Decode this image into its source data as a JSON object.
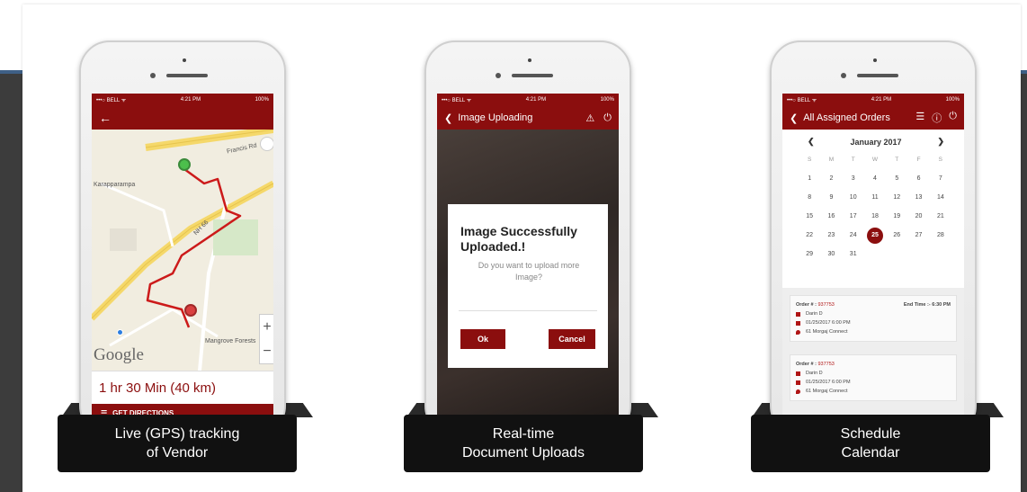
{
  "colors": {
    "brand_red": "#8b0e0e",
    "accent_blue": "#3e5f86",
    "caption_bg": "#111111"
  },
  "phones": [
    {
      "status": {
        "carrier": "•••○ BELL ᯤ",
        "time": "4:21 PM",
        "battery": "100%"
      },
      "appbar": {
        "icon": "back-arrow-icon"
      },
      "map": {
        "labels": [
          "Karapparampa",
          "Mangrove Forests",
          "Francis Rd",
          "NH 66"
        ],
        "google": "Google"
      },
      "eta": "1 hr 30 Min (40 km)",
      "directions_label": "GET DIRECTIONS",
      "caption": [
        "Live (GPS) tracking",
        "of Vendor"
      ]
    },
    {
      "status": {
        "carrier": "•••○ BELL ᯤ",
        "time": "4:21 PM",
        "battery": "100%"
      },
      "appbar": {
        "title": "Image Uploading"
      },
      "dialog": {
        "title_1": "Image Successfully",
        "title_2": "Uploaded.!",
        "message": "Do you want to upload more Image?",
        "ok": "Ok",
        "cancel": "Cancel"
      },
      "caption": [
        "Real-time",
        "Document Uploads"
      ]
    },
    {
      "status": {
        "carrier": "•••○ BELL ᯤ",
        "time": "4:21 PM",
        "battery": "100%"
      },
      "appbar": {
        "title": "All Assigned Orders"
      },
      "calendar": {
        "month": "January 2017",
        "weekdays": [
          "S",
          "M",
          "T",
          "W",
          "T",
          "F",
          "S"
        ],
        "days": [
          "",
          "",
          "",
          "",
          "",
          "",
          "",
          "1",
          "2",
          "3",
          "4",
          "5",
          "6",
          "7",
          "8",
          "9",
          "10",
          "11",
          "12",
          "13",
          "14",
          "15",
          "16",
          "17",
          "18",
          "19",
          "20",
          "21",
          "22",
          "23",
          "24",
          "25",
          "26",
          "27",
          "28",
          "29",
          "30",
          "31"
        ],
        "selected": "25"
      },
      "orders": [
        {
          "order_label": "Order # :",
          "order_no": "937753",
          "name": "Darin D",
          "date": "01/25/2017 6:00 PM",
          "address": "61 Morgaj Connect",
          "end_time": "End Time :- 6:30 PM"
        },
        {
          "order_label": "Order # :",
          "order_no": "937753",
          "name": "Darin D",
          "date": "01/25/2017 6:00 PM",
          "address": "61 Morgaj Connect",
          "end_time": ""
        }
      ],
      "caption": [
        "Schedule",
        "Calendar"
      ]
    }
  ]
}
